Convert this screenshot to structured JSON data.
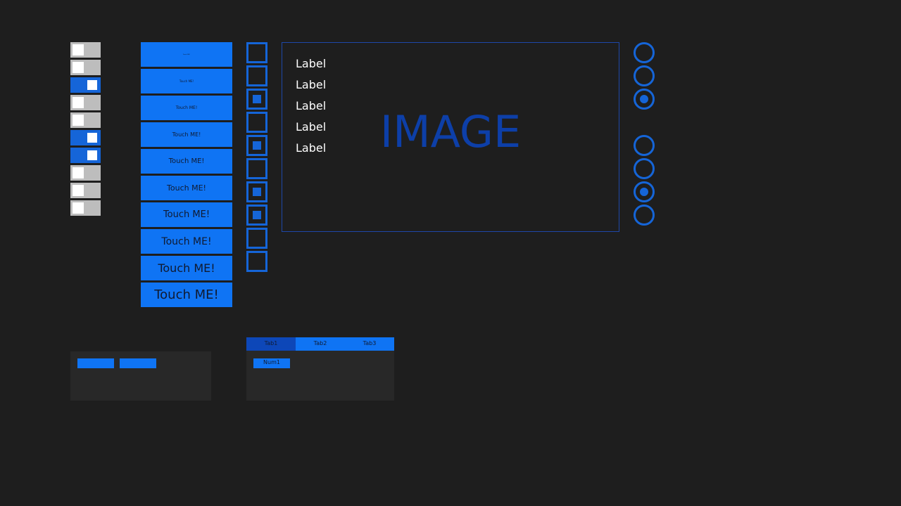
{
  "toggles": [
    {
      "state": "off"
    },
    {
      "state": "off"
    },
    {
      "state": "on"
    },
    {
      "state": "off"
    },
    {
      "state": "off"
    },
    {
      "state": "on"
    },
    {
      "state": "on"
    },
    {
      "state": "off"
    },
    {
      "state": "off"
    },
    {
      "state": "off"
    }
  ],
  "buttons": [
    {
      "label": "Touch ME!"
    },
    {
      "label": "Touch ME!"
    },
    {
      "label": "Touch ME!"
    },
    {
      "label": "Touch ME!"
    },
    {
      "label": "Touch ME!"
    },
    {
      "label": "Touch ME!"
    },
    {
      "label": "Touch ME!"
    },
    {
      "label": "Touch ME!"
    },
    {
      "label": "Touch ME!"
    },
    {
      "label": "Touch ME!"
    }
  ],
  "checkboxes": [
    {
      "checked": false
    },
    {
      "checked": false
    },
    {
      "checked": true
    },
    {
      "checked": false
    },
    {
      "checked": true
    },
    {
      "checked": false
    },
    {
      "checked": true
    },
    {
      "checked": true
    },
    {
      "checked": false
    },
    {
      "checked": false
    }
  ],
  "image_panel": {
    "labels": [
      "Label",
      "Label",
      "Label",
      "Label",
      "Label"
    ],
    "image_text": "IMAGE"
  },
  "radio_groups": [
    {
      "options": 3,
      "selected_index": 2
    },
    {
      "options": 4,
      "selected_index": 2
    }
  ],
  "tabs": {
    "labels": [
      "Tab1",
      "Tab2",
      "Tab3"
    ],
    "active_index": 0,
    "content_button": "Num1"
  },
  "colors": {
    "background": "#1e1e1e",
    "accent": "#0f74f4",
    "accent_dark": "#1565d8",
    "image_text": "#0d3fa8"
  }
}
